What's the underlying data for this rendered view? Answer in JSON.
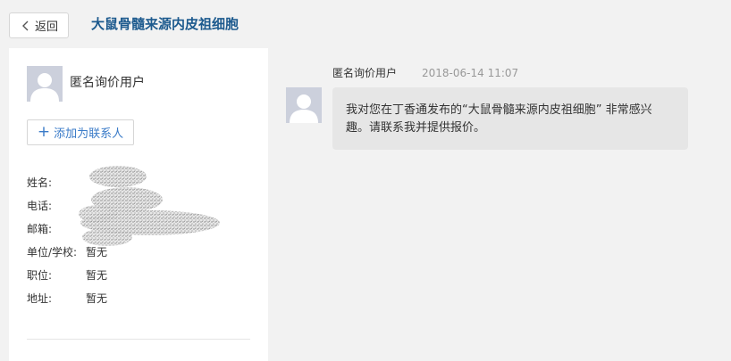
{
  "header": {
    "back_label": "返回",
    "title": "大鼠骨髓来源内皮祖细胞"
  },
  "profile": {
    "user_name": "匿名询价用户",
    "add_contact_label": "添加为联系人",
    "fields": [
      {
        "label": "姓名:",
        "value": ""
      },
      {
        "label": "电话:",
        "value": ""
      },
      {
        "label": "邮箱:",
        "value": ""
      },
      {
        "label": "单位/学校:",
        "value": "暂无"
      },
      {
        "label": "职位:",
        "value": "暂无"
      },
      {
        "label": "地址:",
        "value": "暂无"
      }
    ]
  },
  "message": {
    "sender": "匿名询价用户",
    "time": "2018-06-14 11:07",
    "text": "我对您在丁香通发布的“大鼠骨髓来源内皮祖细胞” 非常感兴趣。请联系我并提供报价。"
  },
  "colors": {
    "title": "#1d5a8e",
    "link": "#3a7bc8",
    "bubble": "#e6e6e6",
    "avatar": "#ccd0dc"
  },
  "icons": {
    "back": "chevron-left-icon",
    "add": "plus-icon",
    "avatar": "user-silhouette-icon"
  }
}
